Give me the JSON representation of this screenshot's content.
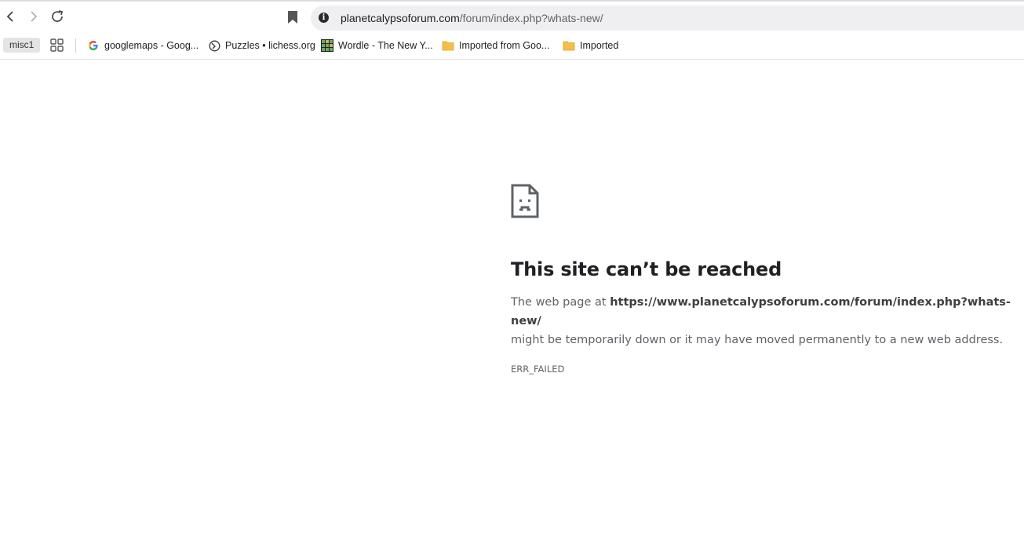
{
  "toolbar": {
    "url_host": "planetcalypsoforum.com",
    "url_path": "/forum/index.php?whats-new/"
  },
  "bookmarks_bar": {
    "chip_label": "misc1",
    "items": [
      {
        "label": "googlemaps - Goog...",
        "icon": "google-icon"
      },
      {
        "label": "Puzzles • lichess.org",
        "icon": "lichess-icon"
      },
      {
        "label": "Wordle - The New Y...",
        "icon": "wordle-icon"
      },
      {
        "label": "Imported from Goo...",
        "icon": "folder-icon"
      },
      {
        "label": "Imported",
        "icon": "folder-icon"
      }
    ]
  },
  "error_page": {
    "title": "This site can’t be reached",
    "desc_prefix": "The web page at ",
    "desc_url": "https://www.planetcalypsoforum.com/forum/index.php?whats-new/",
    "desc_suffix": "might be temporarily down or it may have moved permanently to a new web address.",
    "error_code": "ERR_FAILED"
  },
  "colors": {
    "omnibox_bg": "#efeff2",
    "title_text": "#202124",
    "secondary_text": "#5f6368",
    "folder_yellow": "#f2c04a"
  }
}
